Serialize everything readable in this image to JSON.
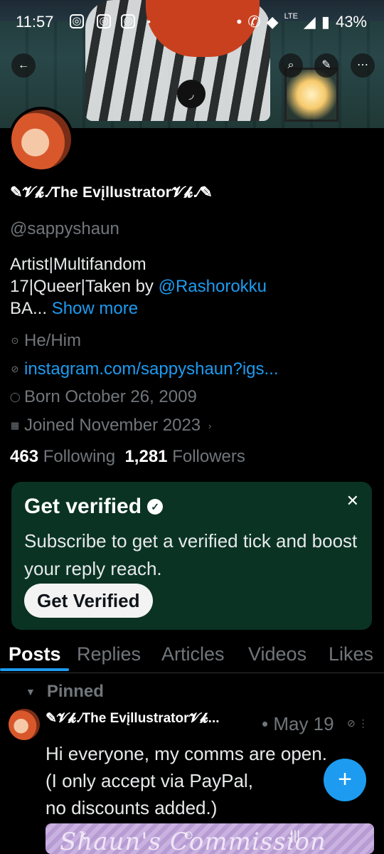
{
  "status_bar": {
    "time": "11:57",
    "notification_icons": [
      "instagram-icon",
      "instagram-icon",
      "instagram-icon"
    ],
    "dot": "•",
    "network": "LTE",
    "battery": "43%"
  },
  "header": {
    "back_icon": "←",
    "search_icon": "⌕",
    "edit_icon": "✎",
    "more_icon": "⋯",
    "refresh_icon": "◞"
  },
  "profile": {
    "display_name": "✎𝓥𝓴.⁄The Evįllustrator𝓥𝓴.⁄✎",
    "handle": "@sappyshaun",
    "bio_line1": "Artist|Multifandom",
    "bio_line2_prefix": "17|Queer|Taken by ",
    "bio_mention": "@Rashorokku",
    "bio_line3_prefix": "BA... ",
    "show_more": "Show more",
    "pronouns": "He/Him",
    "website": "instagram.com/sappyshaun?igs...",
    "birthday": "Born October 26, 2009",
    "joined": "Joined November 2023",
    "following_count": "463",
    "following_label": "Following",
    "followers_count": "1,281",
    "followers_label": "Followers"
  },
  "verify_card": {
    "title": "Get verified",
    "description": "Subscribe to get a verified tick and boost your reply reach.",
    "button": "Get Verified",
    "close": "✕"
  },
  "tabs": [
    "Posts",
    "Replies",
    "Articles",
    "Videos",
    "Likes"
  ],
  "active_tab": "Posts",
  "pinned_post": {
    "pinned_label": "Pinned",
    "author": "✎𝓥𝓴.⁄The Evįllustrator𝓥𝓴...",
    "date": "• May 19",
    "text_line1": "Hi everyone, my comms are open.",
    "text_line2": "(I only accept via PayPal,",
    "text_line3": "no discounts added.)",
    "image_text": "Shaun's Commission Prices"
  },
  "fab": "+",
  "nav_bar": {
    "back": "‹",
    "home": "○",
    "recents": "|||"
  },
  "colors": {
    "accent": "#1d9bf0",
    "background": "#000000",
    "card": "#0a3324",
    "muted": "#71767b"
  }
}
